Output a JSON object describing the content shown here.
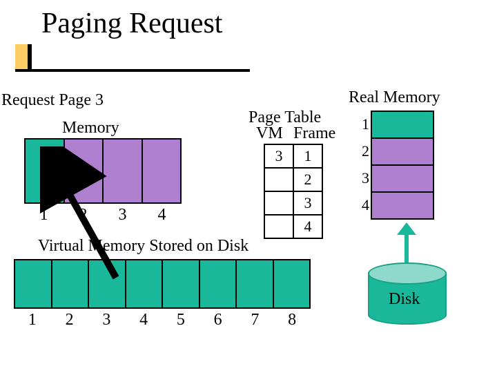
{
  "title": "Paging Request",
  "request_label": "Request Page 3",
  "memory": {
    "label": "Memory",
    "cells": [
      {
        "color": "c-green"
      },
      {
        "color": "c-violet"
      },
      {
        "color": "c-violet"
      },
      {
        "color": "c-violet"
      }
    ],
    "indices": [
      "1",
      "2",
      "3",
      "4"
    ]
  },
  "page_table": {
    "title": "Page Table",
    "col_vm": "VM",
    "col_frame": "Frame",
    "rows": [
      {
        "vm": "3",
        "frame": "1"
      },
      {
        "vm": "",
        "frame": "2"
      },
      {
        "vm": "",
        "frame": "3"
      },
      {
        "vm": "",
        "frame": "4"
      }
    ]
  },
  "real_memory": {
    "title": "Real Memory",
    "frames": [
      {
        "n": "1",
        "color": "c-green"
      },
      {
        "n": "2",
        "color": "c-violet"
      },
      {
        "n": "3",
        "color": "c-violet"
      },
      {
        "n": "4",
        "color": "c-violet"
      }
    ]
  },
  "vm_disk": {
    "title": "Virtual Memory Stored on Disk",
    "indices": [
      "1",
      "2",
      "3",
      "4",
      "5",
      "6",
      "7",
      "8"
    ]
  },
  "disk_label": "Disk",
  "colors": {
    "green": "#19b89a",
    "violet": "#b080d0",
    "accent": "#ffcc66"
  }
}
